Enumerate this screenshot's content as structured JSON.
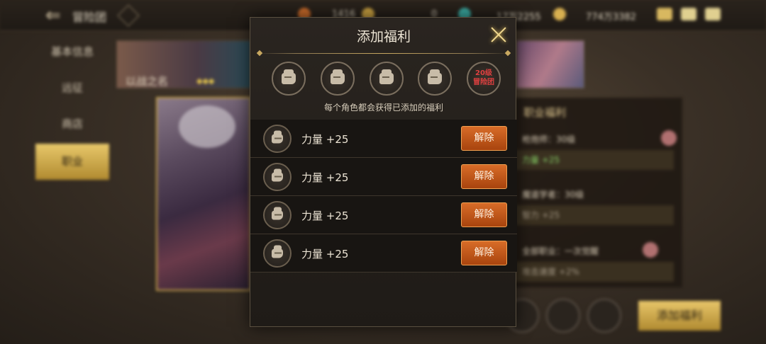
{
  "topbar": {
    "title": "冒险团",
    "resources": [
      "1416",
      "0",
      "17万2255",
      "774万3382"
    ]
  },
  "sidebar": {
    "items": [
      {
        "label": "基本信息"
      },
      {
        "label": "远征"
      },
      {
        "label": "商店"
      },
      {
        "label": "职业"
      }
    ],
    "active": "职业"
  },
  "banner": {
    "title": "以战之名"
  },
  "right_panel": {
    "title": "职业福利",
    "rows": [
      {
        "label": "枪炮师：30级",
        "bonus": "力量 +25"
      },
      {
        "label": "魔道学者：30级",
        "bonus": "智力 +25"
      },
      {
        "label": "全部职业：一次觉醒",
        "bonus": "攻击速度 +2%"
      }
    ]
  },
  "bottom": {
    "add_benefit_label": "添加福利"
  },
  "modal": {
    "title": "添加福利",
    "locked_slot": {
      "line1": "20级",
      "line2": "冒险团"
    },
    "subtitle": "每个角色都会获得已添加的福利",
    "rows": [
      {
        "text": "力量 +25",
        "button": "解除"
      },
      {
        "text": "力量 +25",
        "button": "解除"
      },
      {
        "text": "力量 +25",
        "button": "解除"
      },
      {
        "text": "力量 +25",
        "button": "解除"
      }
    ]
  },
  "colors": {
    "accent_gold": "#c8a44a",
    "remove_button": "#c05a1c",
    "modal_bg": "#221e1a"
  }
}
